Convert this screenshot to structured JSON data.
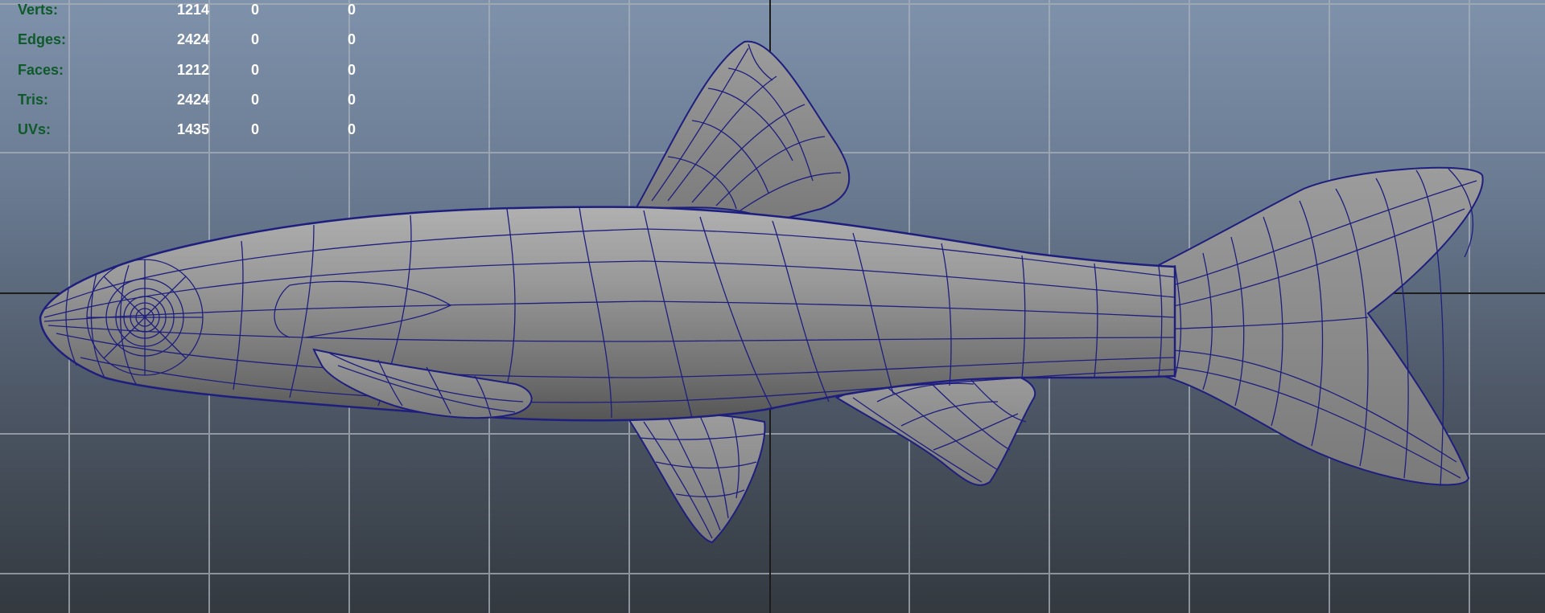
{
  "viewport": {
    "background_top": "#7f92ab",
    "background_bottom": "#33393f",
    "grid_color": "#a9b0b9",
    "axis_color": "#1c1c1c",
    "mesh_fill": "#8e8e8e",
    "wire_color": "#1e1e7e"
  },
  "hud": {
    "rows": [
      {
        "label": "Verts:",
        "v1": "1214",
        "v2": "0",
        "v3": "0"
      },
      {
        "label": "Edges:",
        "v1": "2424",
        "v2": "0",
        "v3": "0"
      },
      {
        "label": "Faces:",
        "v1": "1212",
        "v2": "0",
        "v3": "0"
      },
      {
        "label": "Tris:",
        "v1": "2424",
        "v2": "0",
        "v3": "0"
      },
      {
        "label": "UVs:",
        "v1": "1435",
        "v2": "0",
        "v3": "0"
      }
    ]
  },
  "model": {
    "icon": "fish-wireframe-mesh"
  }
}
